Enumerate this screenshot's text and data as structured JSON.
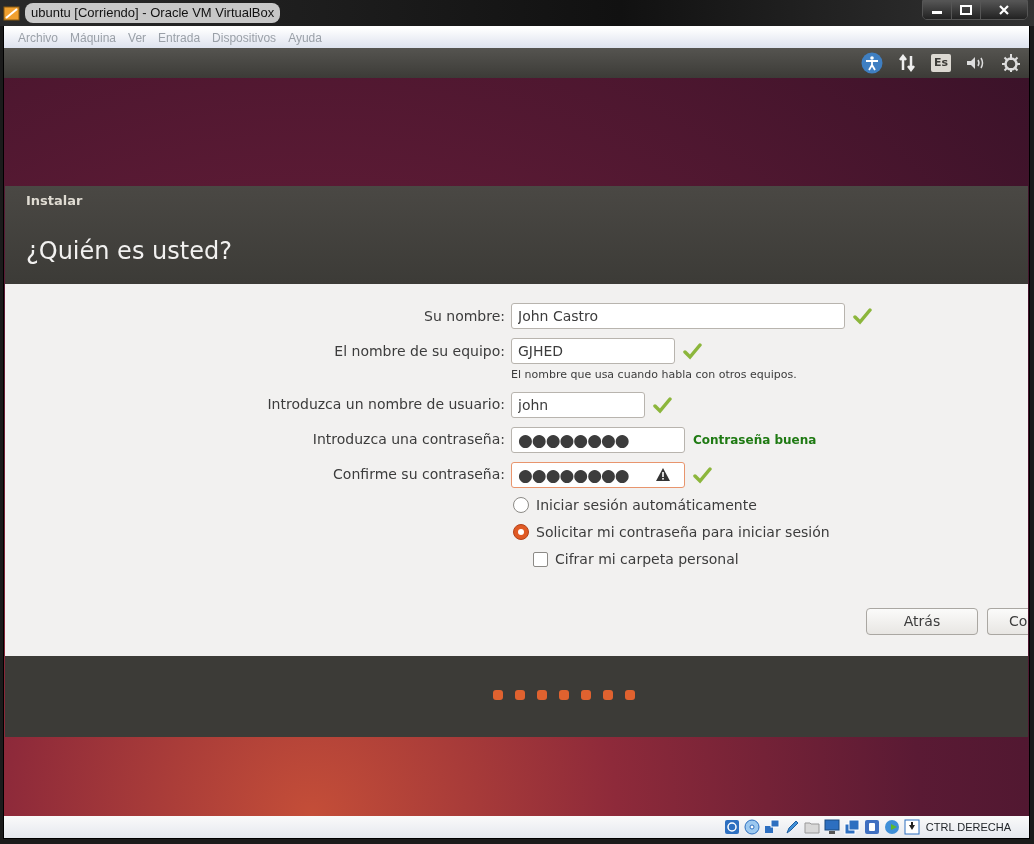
{
  "window": {
    "title": "ubuntu [Corriendo] - Oracle VM VirtualBox"
  },
  "menu": [
    "Archivo",
    "Máquina",
    "Ver",
    "Entrada",
    "Dispositivos",
    "Ayuda"
  ],
  "top_panel": {
    "keyboard_layout": "Es"
  },
  "installer": {
    "title": "Instalar",
    "heading": "¿Quién es usted?",
    "fields": [
      {
        "kind": "text",
        "label": "Su nombre:",
        "value": "John Castro",
        "valid": true,
        "warning": false
      },
      {
        "kind": "text",
        "label": "El nombre de su equipo:",
        "value": "GJHED",
        "valid": true,
        "warning": false,
        "hint": "El nombre que usa cuando habla con otros equipos."
      },
      {
        "kind": "text",
        "label": "Introduzca un nombre de usuario:",
        "value": "john",
        "valid": true,
        "warning": false
      },
      {
        "kind": "password",
        "label": "Introduzca una contraseña:",
        "value": "●●●●●●●●",
        "valid": false,
        "warning": false,
        "strength": "Contraseña buena"
      },
      {
        "kind": "password",
        "label": "Confirme su contraseña:",
        "value": "●●●●●●●●",
        "valid": true,
        "warning": true
      }
    ],
    "login_options": [
      {
        "label": "Iniciar sesión automáticamente",
        "selected": false
      },
      {
        "label": "Solicitar mi contraseña para iniciar sesión",
        "selected": true
      }
    ],
    "encrypt": {
      "label": "Cifrar mi carpeta personal",
      "checked": false
    },
    "buttons": [
      "Atrás",
      "Co"
    ],
    "steps": [
      {
        "done": true
      },
      {
        "done": true
      },
      {
        "done": true
      },
      {
        "done": true
      },
      {
        "done": true
      },
      {
        "done": true
      },
      {
        "done": true
      }
    ]
  },
  "status_bar": {
    "host_key": "CTRL DERECHA"
  }
}
